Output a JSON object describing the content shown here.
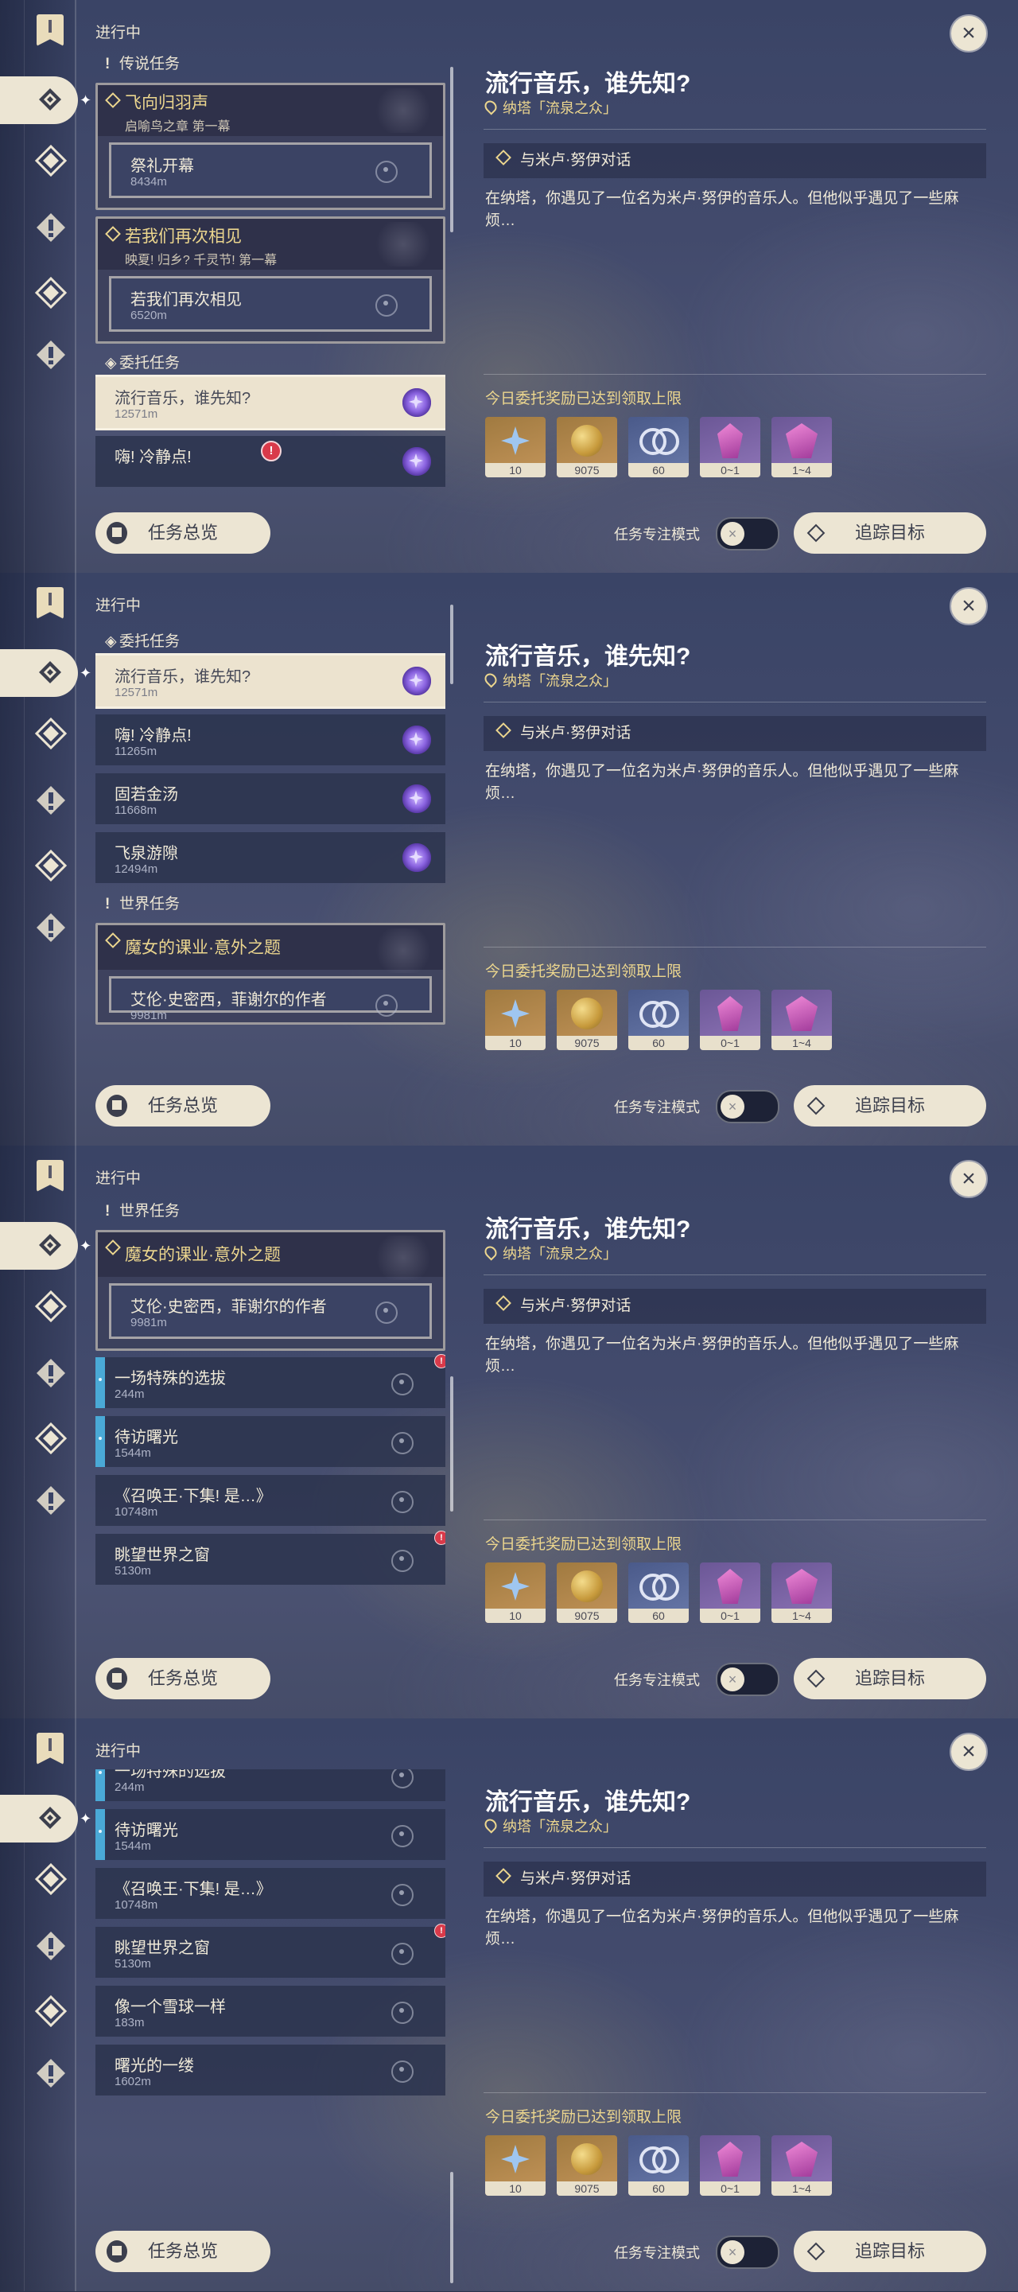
{
  "header": {
    "in_progress": "进行中"
  },
  "quest_detail": {
    "title": "流行音乐，谁先知?",
    "location": "纳塔「流泉之众」",
    "objective": "与米卢·努伊对话",
    "description": "在纳塔，你遇见了一位名为米卢·努伊的音乐人。但他似乎遇见了一些麻烦…",
    "reward_notice": "今日委托奖励已达到领取上限",
    "rewards": [
      {
        "icon": "primogem-icon",
        "count": "10"
      },
      {
        "icon": "mora-icon",
        "count": "9075"
      },
      {
        "icon": "companionship-exp-icon",
        "count": "60"
      },
      {
        "icon": "crystal-icon",
        "count": "0~1"
      },
      {
        "icon": "crystal-chunk-icon",
        "count": "1~4"
      }
    ]
  },
  "bottom": {
    "overview_label": "任务总览",
    "focus_mode_label": "任务专注模式",
    "track_label": "追踪目标"
  },
  "sections": {
    "legend": "传说任务",
    "commissions": "委托任务",
    "world": "世界任务"
  },
  "legend_quests": [
    {
      "title": "飞向归羽声",
      "chapter": "启喻鸟之章 第一幕",
      "sub_name": "祭礼开幕",
      "sub_dist": "8434m"
    },
    {
      "title": "若我们再次相见",
      "chapter": "映夏! 归乡? 千灵节! 第一幕",
      "sub_name": "若我们再次相见",
      "sub_dist": "6520m"
    }
  ],
  "commissions": [
    {
      "name": "流行音乐，谁先知?",
      "dist": "12571m"
    },
    {
      "name": "嗨! 冷静点!",
      "dist": "11265m"
    },
    {
      "name": "固若金汤",
      "dist": "11668m"
    },
    {
      "name": "飞泉游隙",
      "dist": "12494m"
    }
  ],
  "world_group": {
    "title": "魔女的课业·意外之题",
    "sub_name": "艾伦·史密西，菲谢尔的作者",
    "sub_dist": "9981m"
  },
  "world_quests": [
    {
      "name": "一场特殊的选拔",
      "dist": "244m"
    },
    {
      "name": "待访曙光",
      "dist": "1544m"
    },
    {
      "name": "《召唤王·下集! 是…》",
      "dist": "10748m"
    },
    {
      "name": "眺望世界之窗",
      "dist": "5130m"
    },
    {
      "name": "像一个雪球一样",
      "dist": "183m"
    },
    {
      "name": "曙光的一缕",
      "dist": "1602m"
    }
  ],
  "clipped": {
    "top_item_dist": "6520m",
    "trunc_item": "艾伦·史密西，菲谢尔的作者",
    "trunc_dist": "11265m"
  },
  "colors": {
    "accent_gold": "#ecd68e",
    "panel_cream": "#ece5d3",
    "alert_red": "#d93a4a",
    "world_blue": "#4aa9d6"
  }
}
